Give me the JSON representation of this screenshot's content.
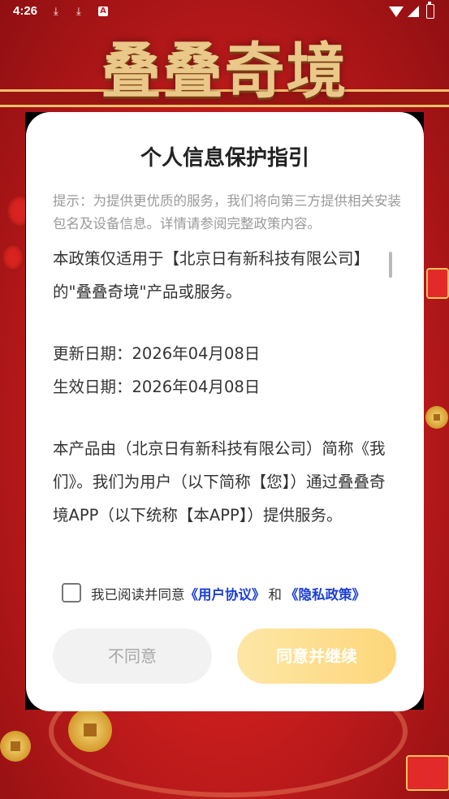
{
  "status_bar": {
    "time": "4:26",
    "icons": [
      "download-icon",
      "download-icon",
      "a-icon",
      "wifi-icon",
      "signal-icon",
      "battery-icon"
    ],
    "a_icon_text": "A"
  },
  "background": {
    "title": "叠叠奇境"
  },
  "dialog": {
    "title": "个人信息保护指引",
    "hint": "提示：为提供更优质的服务，我们将向第三方提供相关安装包名及设备信息。详情请参阅完整政策内容。",
    "policy": {
      "intro": "本政策仅适用于【北京日有新科技有限公司】的\"叠叠奇境\"产品或服务。",
      "update_date": "更新日期：2026年04月08日",
      "effective_date": "生效日期：2026年04月08日",
      "body": "本产品由（北京日有新科技有限公司）简称《我们》。我们为用户（以下简称【您】）通过叠叠奇境APP（以下统称【本APP】）提供服务。"
    },
    "consent": {
      "checked": false,
      "prefix": "我已阅读并同意",
      "user_agreement": "《用户协议》",
      "and": "和",
      "privacy_policy": "《隐私政策》"
    },
    "buttons": {
      "disagree": "不同意",
      "agree": "同意并继续"
    }
  },
  "colors": {
    "link": "#1a3fd6",
    "agree_button": "#fdd67a",
    "background_red": "#c81d1d"
  }
}
